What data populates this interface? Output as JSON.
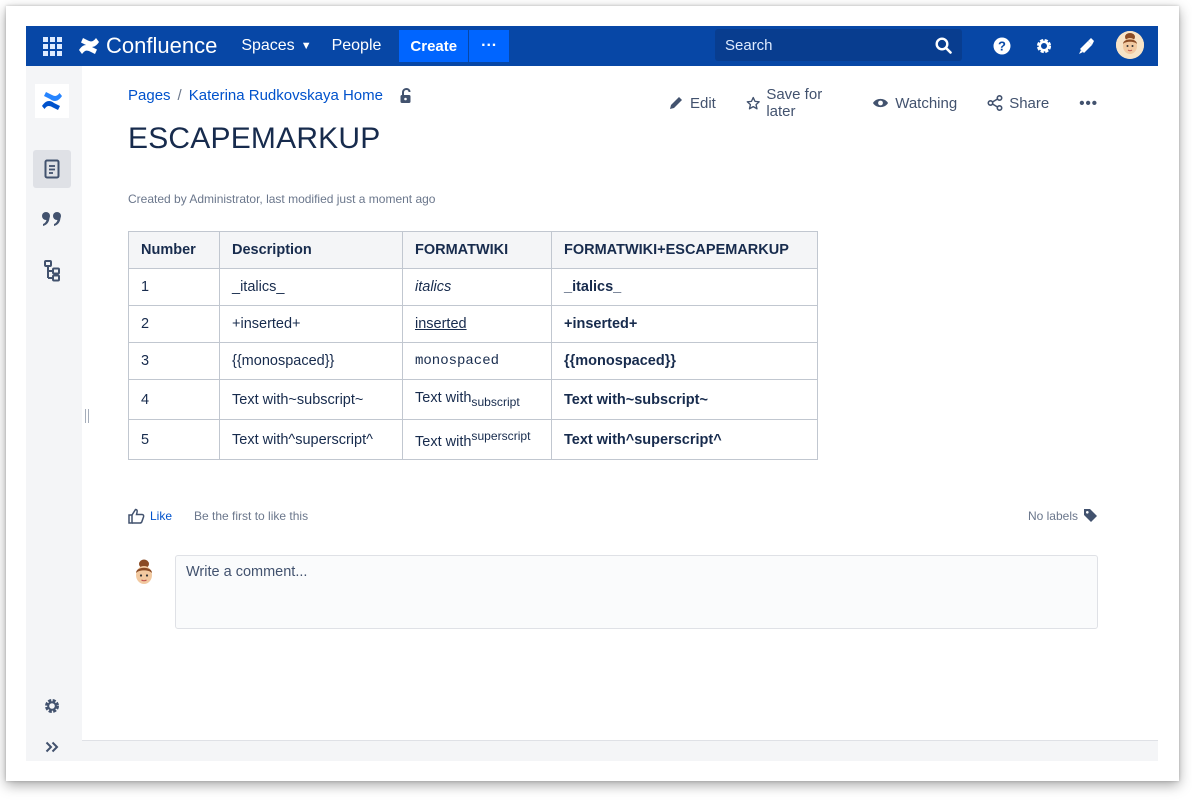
{
  "topnav": {
    "app_name": "Confluence",
    "spaces_label": "Spaces",
    "people_label": "People",
    "create_label": "Create",
    "more_label": "···",
    "search_placeholder": "Search"
  },
  "breadcrumb": {
    "root": "Pages",
    "separator": "/",
    "parent": "Katerina Rudkovskaya Home"
  },
  "page_actions": {
    "edit": "Edit",
    "save_for_later": "Save for later",
    "watching": "Watching",
    "share": "Share",
    "more": "•••"
  },
  "page": {
    "title": "ESCAPEMARKUP",
    "byline": "Created by Administrator, last modified just a moment ago"
  },
  "table": {
    "headers": [
      "Number",
      "Description",
      "FORMATWIKI",
      "FORMATWIKI+ESCAPEMARKUP"
    ],
    "rows": [
      {
        "number": "1",
        "description": "_italics_",
        "formatwiki": "italics",
        "escaped": "_italics_"
      },
      {
        "number": "2",
        "description": "+inserted+",
        "formatwiki": "inserted",
        "escaped": "+inserted+"
      },
      {
        "number": "3",
        "description": "{{monospaced}}",
        "formatwiki": "monospaced",
        "escaped": "{{monospaced}}"
      },
      {
        "number": "4",
        "description": "Text with~subscript~",
        "formatwiki_text": "Text with",
        "formatwiki_sub": "subscript",
        "escaped": "Text with~subscript~"
      },
      {
        "number": "5",
        "description": "Text with^superscript^",
        "formatwiki_text": "Text with",
        "formatwiki_sup": "superscript",
        "escaped": "Text with^superscript^"
      }
    ]
  },
  "likes": {
    "like_label": "Like",
    "like_text": "Be the first to like this",
    "labels_text": "No labels"
  },
  "comment": {
    "placeholder": "Write a comment..."
  },
  "colors": {
    "nav_bg": "#0747a6",
    "create_bg": "#0065ff",
    "link": "#0052cc"
  }
}
